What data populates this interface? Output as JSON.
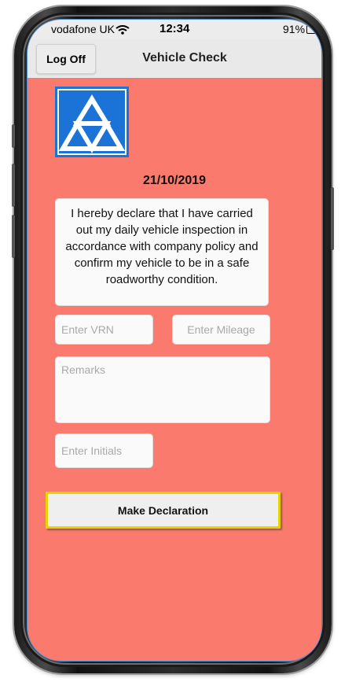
{
  "status_bar": {
    "carrier": "vodafone UK",
    "time": "12:34",
    "battery": "91%"
  },
  "nav": {
    "logoff_label": "Log Off",
    "title": "Vehicle Check"
  },
  "logo": {
    "icon": "mot-triangles-logo",
    "color": "#1b73d8"
  },
  "form": {
    "date": "21/10/2019",
    "declaration_text": "I hereby declare that I have carried out my daily vehicle inspection in accordance with company policy and confirm my vehicle to be in a safe roadworthy condition.",
    "vrn_placeholder": "Enter VRN",
    "mileage_placeholder": "Enter Mileage",
    "remarks_placeholder": "Remarks",
    "initials_placeholder": "Enter Initials",
    "submit_label": "Make Declaration"
  },
  "colors": {
    "background": "#fa7b6e",
    "button_border": "#e4d400",
    "nav_background": "#e9e9e9"
  }
}
